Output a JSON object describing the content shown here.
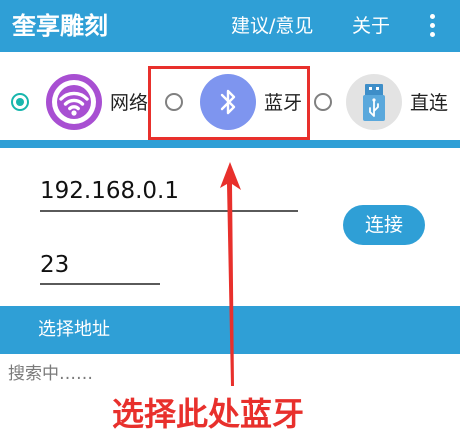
{
  "appbar": {
    "title": "奎享雕刻",
    "feedback_label": "建议/意见",
    "about_label": "关于",
    "overflow_icon": "more-vertical-icon"
  },
  "modes": {
    "selected": "network",
    "items": [
      {
        "id": "network",
        "label": "网络",
        "icon": "wifi-icon"
      },
      {
        "id": "bluetooth",
        "label": "蓝牙",
        "icon": "bluetooth-icon"
      },
      {
        "id": "direct",
        "label": "直连",
        "icon": "usb-icon"
      }
    ]
  },
  "connection": {
    "ip_value": "192.168.0.1",
    "port_value": "23",
    "connect_label": "连接"
  },
  "address": {
    "title": "选择地址",
    "status": "搜索中……"
  },
  "annotation": {
    "text": "选择此处蓝牙"
  },
  "colors": {
    "primary": "#2f9fd6",
    "accent": "#18b6ad",
    "wifi": "#a84fd2",
    "bluetooth": "#7e95ef",
    "annotation": "#e8302c"
  }
}
